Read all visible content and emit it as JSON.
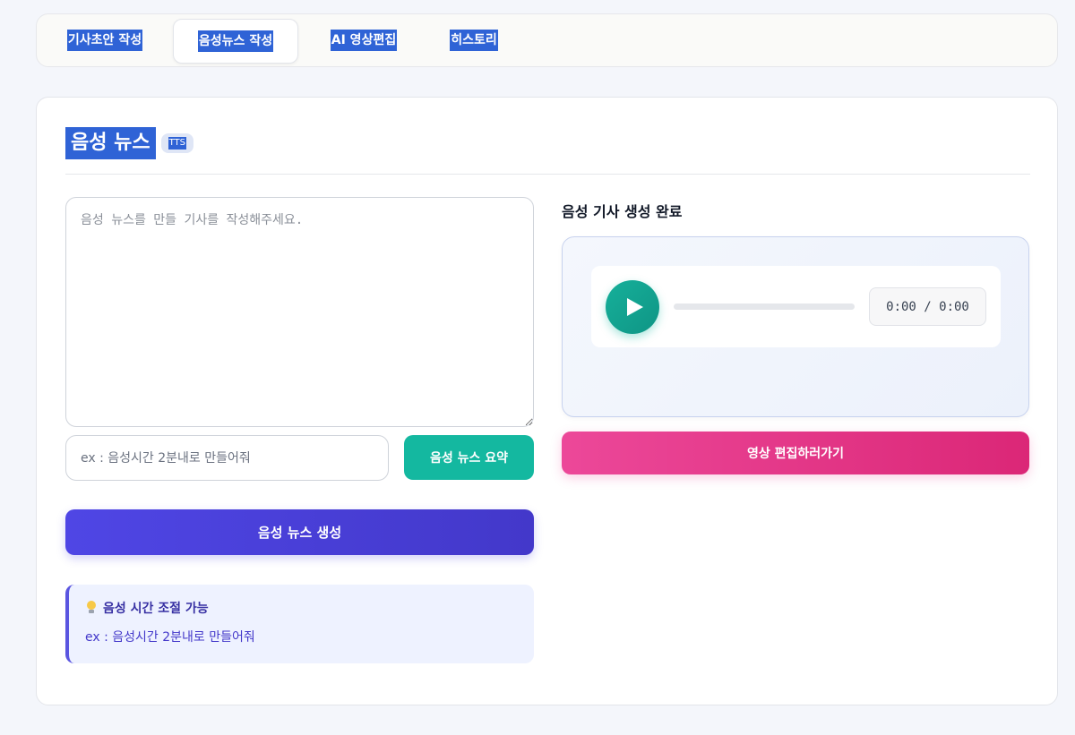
{
  "tabs": [
    {
      "label": "기사초안 작성",
      "active": false
    },
    {
      "label": "음성뉴스 작성",
      "active": true
    },
    {
      "label": "AI 영상편집",
      "active": false
    },
    {
      "label": "히스토리",
      "active": false
    }
  ],
  "card": {
    "title": "음성 뉴스",
    "badge": "TTS"
  },
  "left": {
    "article_placeholder": "음성 뉴스를 만들 기사를 작성해주세요.",
    "article_value": "",
    "duration_placeholder": "ex : 음성시간 2분내로 만들어줘",
    "duration_value": "",
    "summarize_label": "음성 뉴스 요약",
    "generate_label": "음성 뉴스 생성",
    "tip": {
      "icon": "lightbulb-icon",
      "title": "음성 시간 조절 가능",
      "body": "ex : 음성시간 2분내로 만들어줘"
    }
  },
  "right": {
    "status_label": "음성 기사 생성 완료",
    "player": {
      "time": "0:00 / 0:00",
      "progress": 0
    },
    "edit_label": "영상 편집하러가기"
  },
  "colors": {
    "accent_teal": "#14b8a0",
    "accent_indigo": "#4f46e5",
    "accent_pink": "#ec4899",
    "selection_blue": "#2f63d6"
  }
}
